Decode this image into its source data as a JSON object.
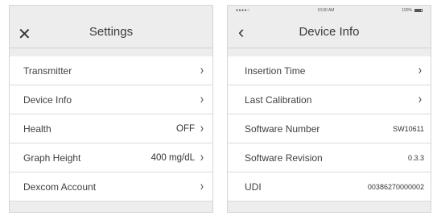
{
  "settings_screen": {
    "title": "Settings",
    "close_glyph": "✕",
    "items": [
      {
        "label": "Transmitter",
        "value": ""
      },
      {
        "label": "Device Info",
        "value": ""
      },
      {
        "label": "Health",
        "value": "OFF"
      },
      {
        "label": "Graph Height",
        "value": "400 mg/dL"
      },
      {
        "label": "Dexcom Account",
        "value": ""
      }
    ]
  },
  "device_info_screen": {
    "status": {
      "signal": "●●●●○",
      "time": "10:00 AM",
      "battery": "100%"
    },
    "back_glyph": "‹",
    "title": "Device Info",
    "items": [
      {
        "label": "Insertion Time",
        "value": ""
      },
      {
        "label": "Last Calibration",
        "value": ""
      },
      {
        "label": "Software Number",
        "value": "SW10611"
      },
      {
        "label": "Software Revision",
        "value": "0.3.3"
      },
      {
        "label": "UDI",
        "value": "00386270000002"
      }
    ]
  },
  "chevron_glyph": "›"
}
